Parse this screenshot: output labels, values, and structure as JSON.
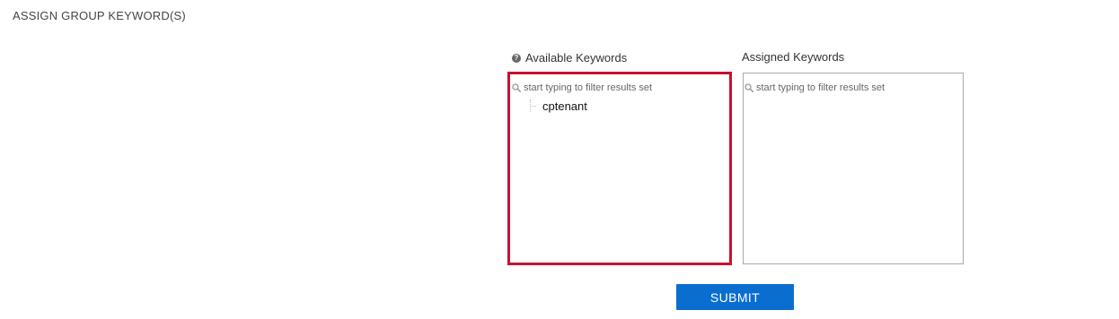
{
  "page": {
    "title": "ASSIGN GROUP KEYWORD(S)"
  },
  "available": {
    "label": "Available Keywords",
    "help_icon": "question-circle-icon",
    "filter_placeholder": "start typing to filter results set",
    "items": [
      {
        "label": "cptenant"
      }
    ]
  },
  "assigned": {
    "label": "Assigned Keywords",
    "filter_placeholder": "start typing to filter results set",
    "items": []
  },
  "actions": {
    "submit_label": "SUBMIT"
  },
  "colors": {
    "highlight_border": "#c8102e",
    "submit_background": "#0a6ed1",
    "submit_text": "#ffffff"
  }
}
